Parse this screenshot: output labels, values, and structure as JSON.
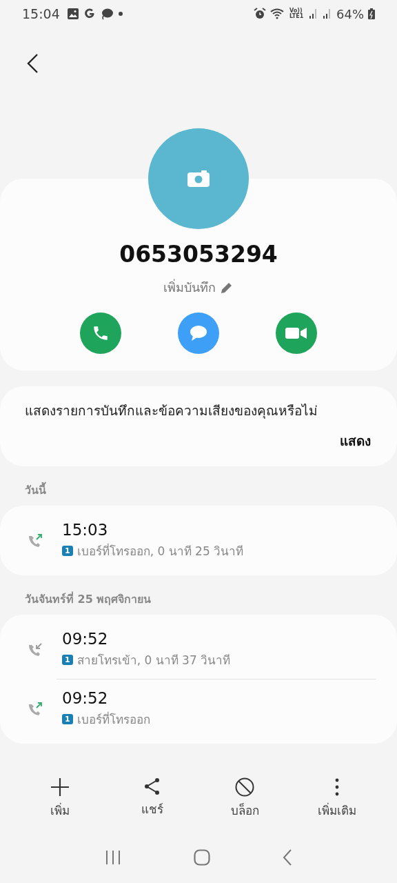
{
  "status_bar": {
    "time": "15:04",
    "battery": "64%",
    "network": "Vo)) LTE1"
  },
  "contact": {
    "number": "0653053294",
    "note_label": "เพิ่มบันทึก"
  },
  "actions": [
    {
      "kind": "call",
      "color": "#1fa45b"
    },
    {
      "kind": "message",
      "color": "#3d9ff5"
    },
    {
      "kind": "video",
      "color": "#1fa45b"
    }
  ],
  "recording_prompt": {
    "text": "แสดงรายการบันทึกและข้อความเสียงของคุณหรือไม่",
    "button": "แสดง"
  },
  "call_groups": [
    {
      "heading": "วันนี้",
      "calls": [
        {
          "kind": "outgoing",
          "time": "15:03",
          "sim": "1",
          "detail": "เบอร์ที่โทรออก, 0 นาที 25 วินาที"
        }
      ]
    },
    {
      "heading": "วันจันทร์ที่ 25 พฤศจิกายน",
      "calls": [
        {
          "kind": "incoming",
          "time": "09:52",
          "sim": "1",
          "detail": "สายโทรเข้า, 0 นาที 37 วินาที"
        },
        {
          "kind": "outgoing",
          "time": "09:52",
          "sim": "1",
          "detail": "เบอร์ที่โทรออก"
        }
      ]
    }
  ],
  "bottom_actions": [
    {
      "kind": "add",
      "label": "เพิ่ม"
    },
    {
      "kind": "share",
      "label": "แชร์"
    },
    {
      "kind": "block",
      "label": "บล็อก"
    },
    {
      "kind": "more",
      "label": "เพิ่มเติม"
    }
  ]
}
